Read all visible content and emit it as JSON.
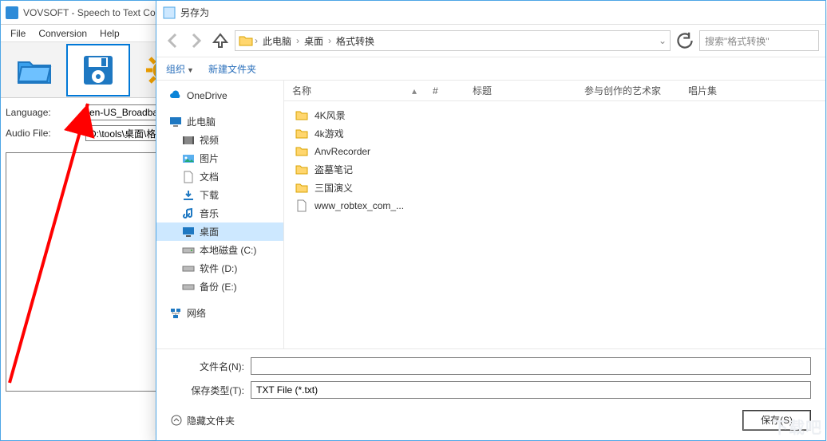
{
  "app": {
    "title": "VOVSOFT - Speech to Text Converter",
    "menus": {
      "file": "File",
      "conversion": "Conversion",
      "help": "Help"
    },
    "labels": {
      "language": "Language:",
      "audiofile": "Audio File:"
    },
    "values": {
      "language": "en-US_Broadban",
      "audiofile": "D:\\tools\\桌面\\格"
    }
  },
  "dialog": {
    "title": "另存为",
    "breadcrumb": {
      "c1": "此电脑",
      "c2": "桌面",
      "c3": "格式转换"
    },
    "search_placeholder": "搜索\"格式转换\"",
    "cmds": {
      "organize": "组织",
      "newfolder": "新建文件夹"
    },
    "columns": {
      "name": "名称",
      "hash": "#",
      "title": "标题",
      "artist": "参与创作的艺术家",
      "album": "唱片集"
    },
    "tree": {
      "onedrive": "OneDrive",
      "thispc": "此电脑",
      "video": "视频",
      "pictures": "图片",
      "docs": "文档",
      "downloads": "下载",
      "music": "音乐",
      "desktop": "桌面",
      "diskc": "本地磁盘 (C:)",
      "diskd": "软件 (D:)",
      "diske": "备份 (E:)",
      "network": "网络"
    },
    "files": {
      "f1": "4K风景",
      "f2": "4k游戏",
      "f3": "AnvRecorder",
      "f4": "盗墓笔记",
      "f5": "三国演义",
      "f6": "www_robtex_com_..."
    },
    "footer": {
      "filename_label": "文件名(N):",
      "filetype_label": "保存类型(T):",
      "filetype_value": "TXT File (*.txt)",
      "hide_folders": "隐藏文件夹",
      "save_btn": "保存(S)"
    }
  },
  "watermark": "下载吧"
}
